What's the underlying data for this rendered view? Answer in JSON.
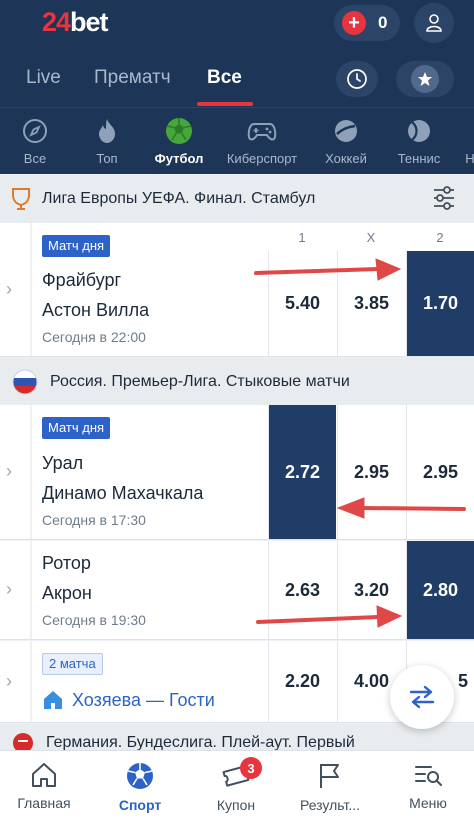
{
  "header": {
    "logo_num": "24",
    "logo_txt": "bet",
    "balance": "0",
    "tabs": [
      "Live",
      "Прематч",
      "Все"
    ]
  },
  "sports": [
    {
      "label": "Все",
      "icon": "compass-icon"
    },
    {
      "label": "Топ",
      "icon": "fire-icon"
    },
    {
      "label": "Футбол",
      "icon": "soccer-ball-icon"
    },
    {
      "label": "Киберспорт",
      "icon": "gamepad-icon"
    },
    {
      "label": "Хоккей",
      "icon": "puck-icon"
    },
    {
      "label": "Теннис",
      "icon": "tennis-ball-icon"
    },
    {
      "label": "Н",
      "icon": "more-sport-icon"
    }
  ],
  "leagues": [
    {
      "name": "Лига Европы УЕФА. Финал. Стамбул",
      "icon": "europa-league-icon"
    },
    {
      "name": "Россия. Премьер-Лига. Стыковые матчи",
      "icon": "russia-flag-icon"
    },
    {
      "name": "Германия. Бундеслига. Плей-аут. Первый",
      "icon": "germany-league-icon"
    }
  ],
  "odds_headers": [
    "1",
    "X",
    "2"
  ],
  "events": [
    {
      "badge": "Матч дня",
      "home": "Фрайбург",
      "away": "Астон Вилла",
      "time": "Сегодня в 22:00",
      "odds": [
        "5.40",
        "3.85",
        "1.70"
      ]
    },
    {
      "badge": "Матч дня",
      "home": "Урал",
      "away": "Динамо Махачкала",
      "time": "Сегодня в 17:30",
      "odds": [
        "2.72",
        "2.95",
        "2.95"
      ]
    },
    {
      "badge": "",
      "home": "Ротор",
      "away": "Акрон",
      "time": "Сегодня в 19:30",
      "odds": [
        "2.63",
        "3.20",
        "2.80"
      ]
    }
  ],
  "aggregate": {
    "badge": "2 матча",
    "label": "Хозяева — Гости",
    "odds": [
      "2.20",
      "4.00",
      "5"
    ]
  },
  "bottom_nav": [
    {
      "label": "Главная",
      "icon": "home-icon"
    },
    {
      "label": "Спорт",
      "icon": "soccer-ball-icon"
    },
    {
      "label": "Купон",
      "icon": "ticket-icon",
      "count": "3"
    },
    {
      "label": "Результ...",
      "icon": "flag-icon"
    },
    {
      "label": "Меню",
      "icon": "menu-search-icon"
    }
  ],
  "colors": {
    "accent": "#e8343f",
    "navy": "#1d3556",
    "highlight": "#1f3d66",
    "link": "#2d63c8"
  }
}
